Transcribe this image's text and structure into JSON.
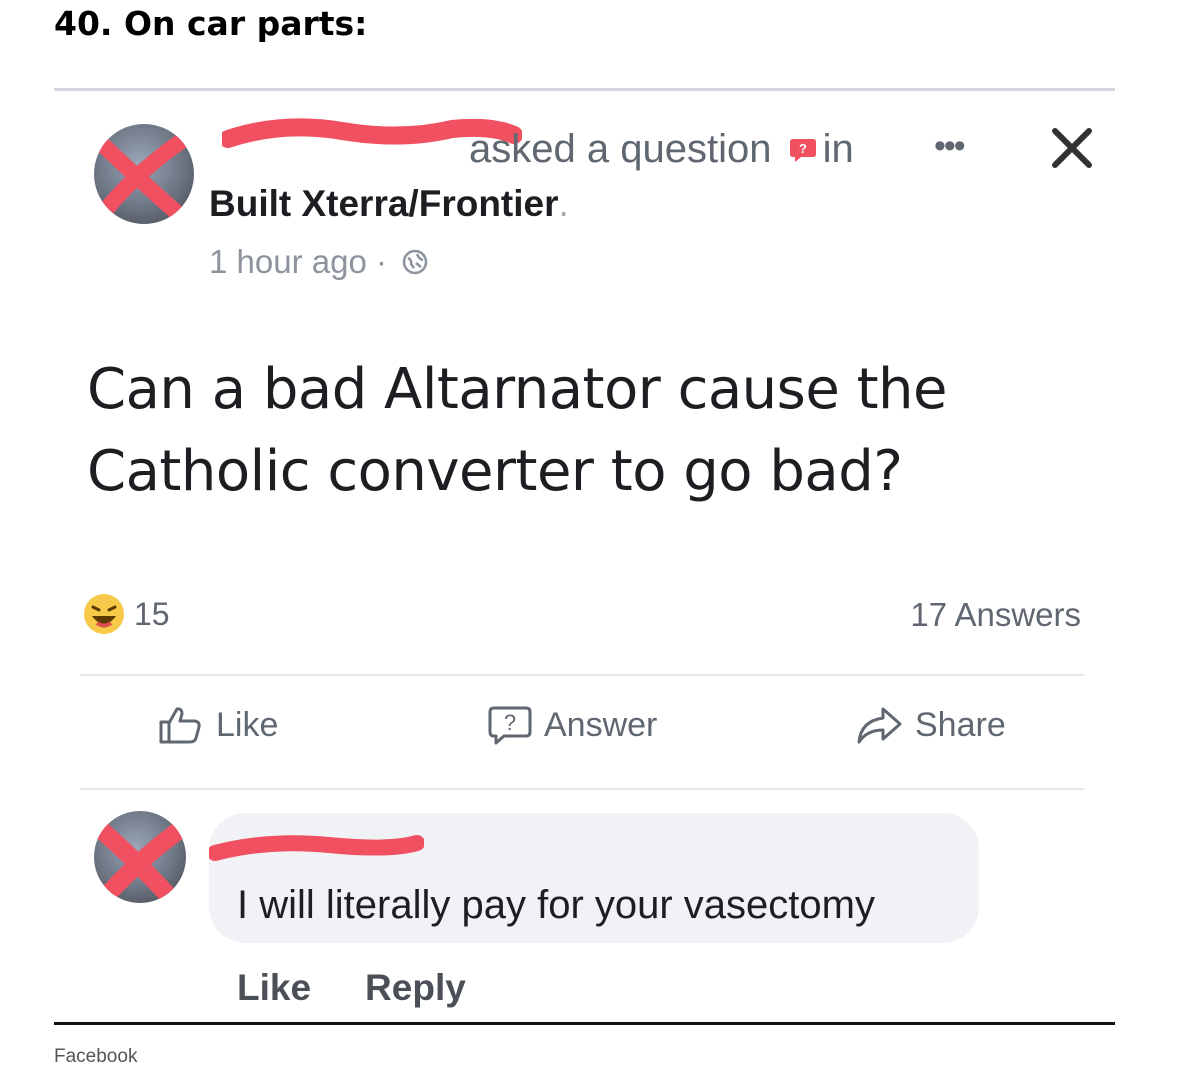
{
  "article": {
    "heading": "40. On car parts:",
    "credit": "Facebook"
  },
  "post": {
    "action_text": "asked a question",
    "in_text": "in",
    "group_name": "Built Xterra/Frontier",
    "group_suffix": ".",
    "timestamp": "1 hour ago",
    "timestamp_separator": "·",
    "question": "Can a bad Altarnator cause the Catholic converter to go bad?",
    "reaction_count": "15",
    "answers_count": "17 Answers",
    "more_label": "•••",
    "actions": {
      "like": "Like",
      "answer": "Answer",
      "share": "Share"
    }
  },
  "comment": {
    "text": "I will literally pay for your vasectomy",
    "like": "Like",
    "reply": "Reply"
  },
  "colors": {
    "redaction": "#f05060",
    "secondary_text": "#606770",
    "bubble": "#f0f2f5"
  }
}
